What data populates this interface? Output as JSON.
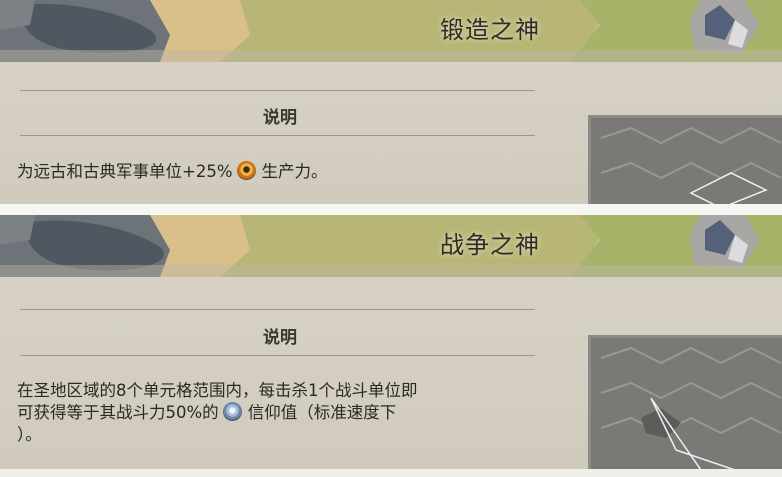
{
  "cards": [
    {
      "title": "锻造之神",
      "section_header": "说明",
      "description_parts": [
        "为远古和古典军事单位+25%",
        "生产力。"
      ],
      "yield_icon": "production-icon"
    },
    {
      "title": "战争之神",
      "section_header": "说明",
      "description_lines": [
        "在圣地区域的8个单元格范围内，每击杀1个战斗单位即",
        "可获得等于其战斗力50%的",
        "信仰值（标准速度下",
        "）。"
      ],
      "yield_icon": "faith-icon"
    }
  ],
  "colors": {
    "parchment": "#d6d1c4",
    "divider": "#9d978a",
    "map_grass": "#b9bd7a",
    "map_water": "#5d6670",
    "production_icon": "#d8882a",
    "faith_icon": "#8aa3c0"
  }
}
